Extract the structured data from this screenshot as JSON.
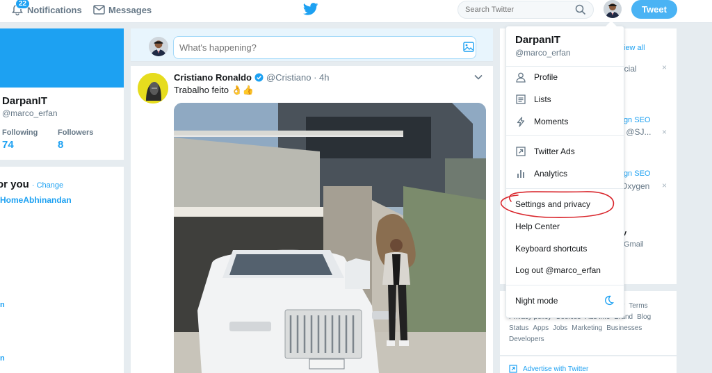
{
  "nav": {
    "notifications_label": "Notifications",
    "notifications_count": "22",
    "messages_label": "Messages",
    "search_placeholder": "Search Twitter",
    "tweet_button": "Tweet"
  },
  "profile": {
    "name": "DarpanIT",
    "handle": "@marco_erfan",
    "following_label": "Following",
    "following_value": "74",
    "followers_label": "Followers",
    "followers_value": "8"
  },
  "trends": {
    "title": "or you",
    "change_link": "· Change",
    "top_tag": "HomeAbhinandan",
    "fragments": [
      "n",
      "n"
    ]
  },
  "compose": {
    "placeholder": "What's happening?"
  },
  "tweet": {
    "name": "Cristiano Ronaldo",
    "handle": "@Cristiano",
    "time": "· 4h",
    "text": "Trabalho feito 👌👍"
  },
  "right": {
    "view_all": "iew all",
    "frag_1": "icial",
    "frag_2": "sign SEO",
    "frag_3": "r @SJ...",
    "frag_4": "sign SEO",
    "frag_5": "Oxygen",
    "frag_6": "v",
    "frag_7": "Gmail"
  },
  "footer": {
    "row1": [
      "r",
      "Terms"
    ],
    "row2": [
      "Privacy policy",
      "Cookies",
      "Ads info",
      "Brand",
      "Blog"
    ],
    "row3": [
      "Status",
      "Apps",
      "Jobs",
      "Marketing",
      "Businesses"
    ],
    "row4": [
      "Developers"
    ],
    "advertise": "Advertise with Twitter"
  },
  "menu": {
    "name": "DarpanIT",
    "handle": "@marco_erfan",
    "profile": "Profile",
    "lists": "Lists",
    "moments": "Moments",
    "twitter_ads": "Twitter Ads",
    "analytics": "Analytics",
    "settings": "Settings and privacy",
    "help": "Help Center",
    "shortcuts": "Keyboard shortcuts",
    "logout": "Log out @marco_erfan",
    "night_mode": "Night mode"
  },
  "colors": {
    "brand_blue": "#1da1f2",
    "annotation_red": "#d9262c"
  },
  "icons": {
    "notifications": "bell-icon",
    "messages": "envelope-icon",
    "logo": "twitter-bird-icon",
    "search": "magnifier-icon",
    "night_mode": "moon-icon"
  }
}
